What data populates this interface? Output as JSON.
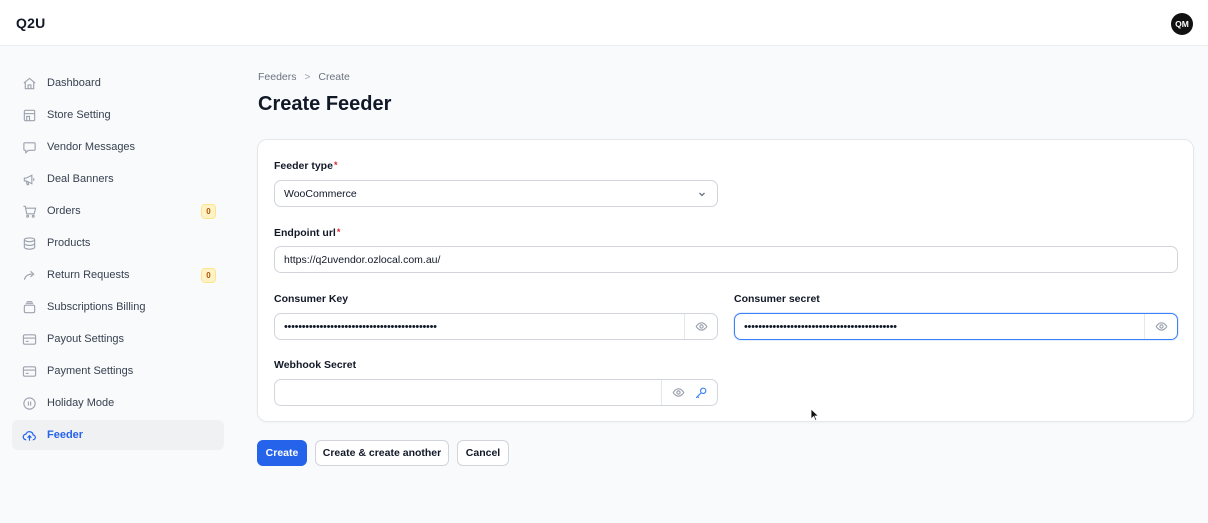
{
  "app": {
    "brand": "Q2U",
    "user_initials": "QM"
  },
  "sidebar": {
    "items": [
      {
        "label": "Dashboard",
        "icon": "home-icon"
      },
      {
        "label": "Store Setting",
        "icon": "store-icon"
      },
      {
        "label": "Vendor Messages",
        "icon": "chat-icon"
      },
      {
        "label": "Deal Banners",
        "icon": "megaphone-icon"
      },
      {
        "label": "Orders",
        "icon": "cart-icon",
        "badge": "0"
      },
      {
        "label": "Products",
        "icon": "database-icon"
      },
      {
        "label": "Return Requests",
        "icon": "return-arrow-icon",
        "badge": "0"
      },
      {
        "label": "Subscriptions Billing",
        "icon": "stack-icon"
      },
      {
        "label": "Payout Settings",
        "icon": "card-icon"
      },
      {
        "label": "Payment Settings",
        "icon": "card-icon"
      },
      {
        "label": "Holiday Mode",
        "icon": "pause-circle-icon"
      },
      {
        "label": "Feeder",
        "icon": "cloud-upload-icon",
        "active": true
      }
    ]
  },
  "breadcrumb": {
    "parent": "Feeders",
    "separator": ">",
    "current": "Create"
  },
  "page": {
    "title": "Create Feeder"
  },
  "form": {
    "feeder_type": {
      "label": "Feeder type",
      "required_mark": "*",
      "value": "WooCommerce"
    },
    "endpoint_url": {
      "label": "Endpoint url",
      "required_mark": "*",
      "value": "https://q2uvendor.ozlocal.com.au/"
    },
    "consumer_key": {
      "label": "Consumer Key",
      "value": "•••••••••••••••••••••••••••••••••••••••••••"
    },
    "consumer_secret": {
      "label": "Consumer secret",
      "value": "•••••••••••••••••••••••••••••••••••••••••••"
    },
    "webhook_secret": {
      "label": "Webhook Secret",
      "value": ""
    }
  },
  "actions": {
    "create": "Create",
    "create_another": "Create & create another",
    "cancel": "Cancel"
  },
  "colors": {
    "primary": "#2563eb",
    "badge_bg": "#fef3c7",
    "required": "#dc2626"
  }
}
